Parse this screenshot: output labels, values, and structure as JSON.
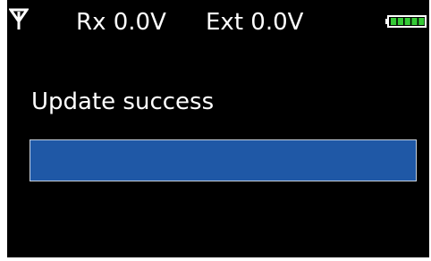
{
  "status_bar": {
    "rx_label": "Rx 0.0V",
    "ext_label": "Ext 0.0V",
    "signal_icon": "antenna-icon",
    "battery_icon": "battery-icon",
    "battery_level": 1.0,
    "battery_color": "#35c936"
  },
  "main": {
    "message": "Update success",
    "progress": 1.0,
    "progress_color": "#1f58a6",
    "progress_border_color": "#c9d2de"
  },
  "colors": {
    "background": "#000000",
    "text": "#ffffff"
  }
}
